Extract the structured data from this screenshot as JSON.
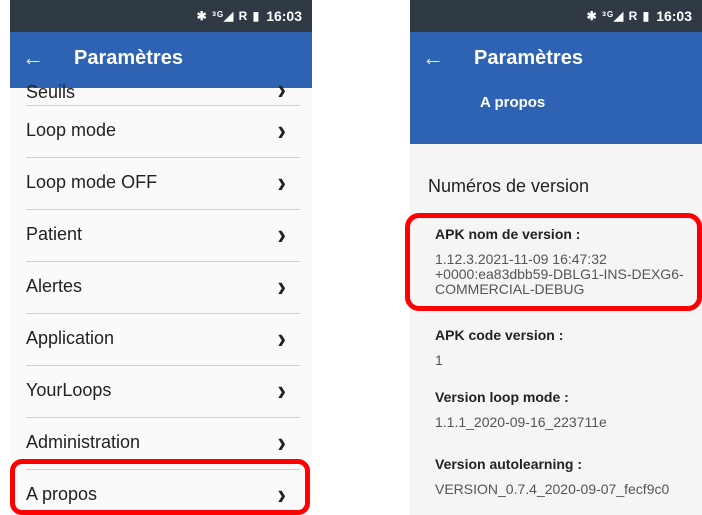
{
  "left": {
    "status": {
      "icons": "✱ ³ᴳ◢ R ▮",
      "time": "16:03"
    },
    "title": "Paramètres",
    "back_glyph": "←",
    "partial_item": "Seuils",
    "items": [
      {
        "label": "Loop mode"
      },
      {
        "label": "Loop mode OFF"
      },
      {
        "label": "Patient"
      },
      {
        "label": "Alertes"
      },
      {
        "label": "Application"
      },
      {
        "label": "YourLoops"
      },
      {
        "label": "Administration"
      },
      {
        "label": "A propos"
      }
    ],
    "chevron": "›"
  },
  "right": {
    "status": {
      "icons": "✱ ³ᴳ◢ R ▮",
      "time": "16:03"
    },
    "title": "Paramètres",
    "subtitle": "A propos",
    "back_glyph": "←",
    "section_title": "Numéros de version",
    "entries": [
      {
        "label": "APK nom de version :",
        "value": "1.12.3.2021-11-09 16:47:32 +0000:ea83dbb59-DBLG1-INS-DEXG6-COMMERCIAL-DEBUG"
      },
      {
        "label": "APK code version :",
        "value": "1"
      },
      {
        "label": "Version loop mode :",
        "value": "1.1.1_2020-09-16_223711e"
      },
      {
        "label": "Version autolearning :",
        "value": "VERSION_0.7.4_2020-09-07_fecf9c0"
      }
    ]
  },
  "colors": {
    "appbar": "#2e62b3",
    "statusbar": "#2f3a45",
    "highlight": "#ff0000"
  }
}
